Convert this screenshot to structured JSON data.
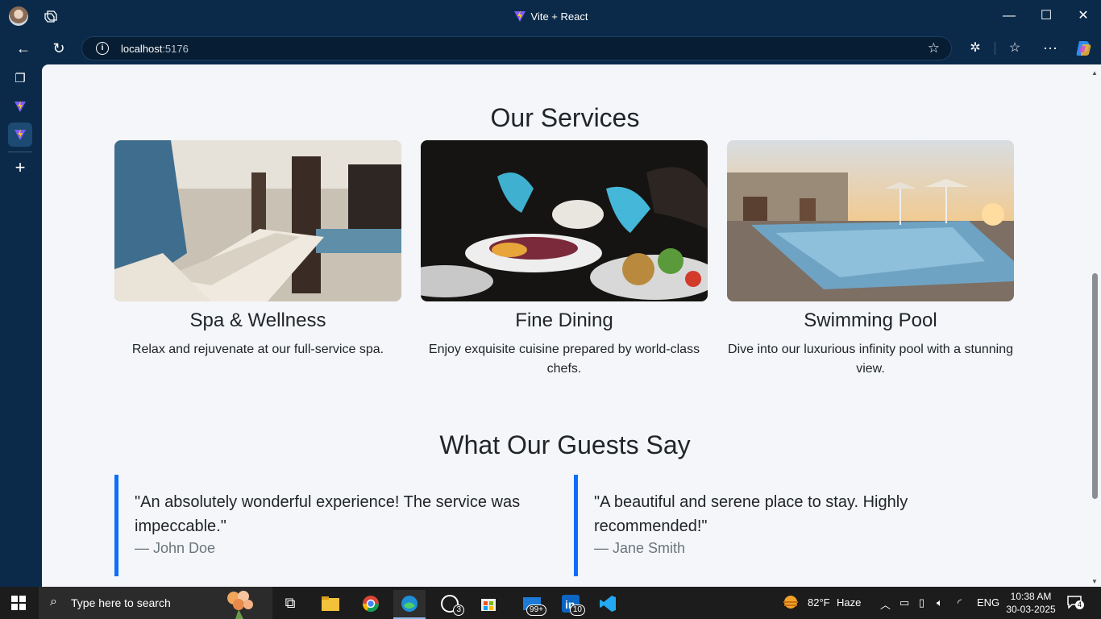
{
  "window": {
    "title": "Vite + React",
    "minimize_icon": "minimize-icon",
    "maximize_icon": "maximize-icon",
    "close_icon": "close-icon"
  },
  "address_bar": {
    "host": "localhost",
    "port": ":5176"
  },
  "services": {
    "heading": "Our Services",
    "items": [
      {
        "title": "Spa & Wellness",
        "description": "Relax and rejuvenate at our full-service spa."
      },
      {
        "title": "Fine Dining",
        "description": "Enjoy exquisite cuisine prepared by world-class chefs."
      },
      {
        "title": "Swimming Pool",
        "description": "Dive into our luxurious infinity pool with a stunning view."
      }
    ]
  },
  "testimonials": {
    "heading": "What Our Guests Say",
    "items": [
      {
        "quote": "\"An absolutely wonderful experience! The service was impeccable.\"",
        "author": "— John Doe"
      },
      {
        "quote": "\"A beautiful and serene place to stay. Highly recommended!\"",
        "author": "— Jane Smith"
      }
    ]
  },
  "taskbar": {
    "search_placeholder": "Type here to search",
    "whatsapp_badge": "3",
    "mail_badge": "99+",
    "linkedin_badge": "10",
    "weather_temp": "82°F",
    "weather_desc": "Haze",
    "language": "ENG",
    "time": "10:38 AM",
    "date": "30-03-2025",
    "notification_count": "4"
  },
  "colors": {
    "accent": "#0d6efd",
    "page_bg": "#f4f6f9",
    "chrome_bg": "#0b2a4a"
  }
}
